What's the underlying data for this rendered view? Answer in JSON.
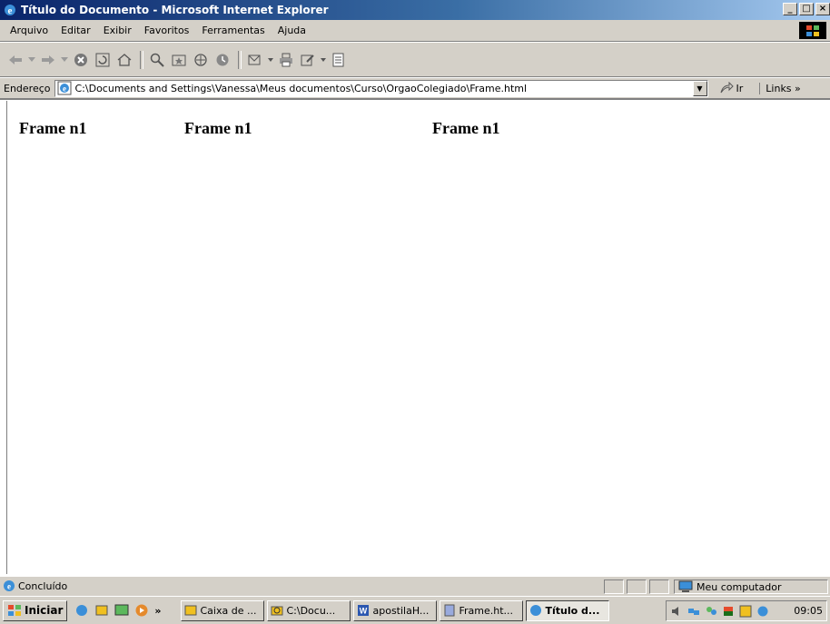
{
  "window": {
    "title": "Título do Documento - Microsoft Internet Explorer"
  },
  "menu": [
    "Arquivo",
    "Editar",
    "Exibir",
    "Favoritos",
    "Ferramentas",
    "Ajuda"
  ],
  "address": {
    "label": "Endereço",
    "value": "C:\\Documents and Settings\\Vanessa\\Meus documentos\\Curso\\OrgaoColegiado\\Frame.html",
    "go_label": "Ir",
    "links_label": "Links »"
  },
  "frames": [
    "Frame n1",
    "Frame n1",
    "Frame n1"
  ],
  "status": {
    "text": "Concluído",
    "zone": "Meu computador"
  },
  "taskbar": {
    "start_label": "Iniciar",
    "chevron": "»",
    "tasks": [
      "Caixa de ...",
      "C:\\Docu...",
      "apostilaH...",
      "Frame.ht...",
      "Título d..."
    ],
    "clock": "09:05"
  },
  "colors": {
    "title_start": "#0a246a",
    "title_end": "#a6caf0",
    "chrome": "#d4d0c8"
  }
}
